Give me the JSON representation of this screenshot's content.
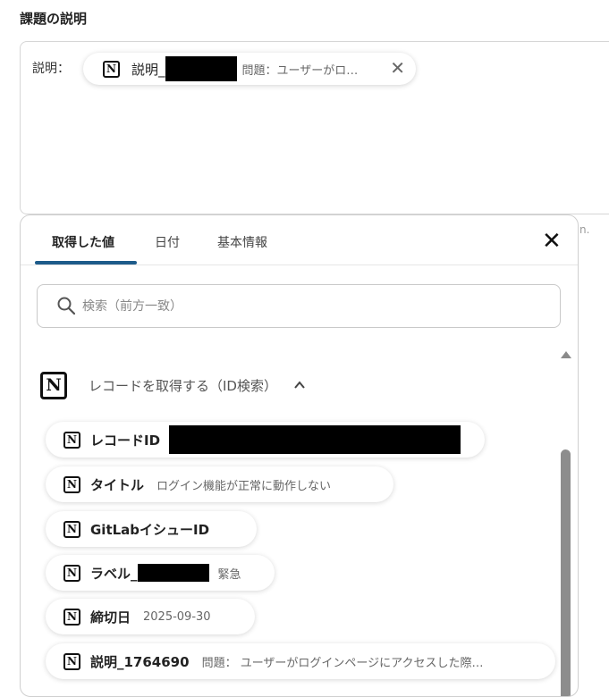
{
  "section_title": "課題の説明",
  "description": {
    "prefix": "説明：",
    "token": {
      "name": "説明_",
      "preview": "問題：ユーザーがロ…"
    }
  },
  "behind_hint": "n.",
  "panel": {
    "tabs": [
      "取得した値",
      "日付",
      "基本情報"
    ],
    "active_tab": 0,
    "search": {
      "placeholder": "検索（前方一致）"
    },
    "group": {
      "title": "レコードを取得する（ID検索）"
    },
    "items": [
      {
        "label": "レコードID",
        "value": ""
      },
      {
        "label": "タイトル",
        "value": "ログイン機能が正常に動作しない"
      },
      {
        "label": "GitLabイシューID",
        "value": ""
      },
      {
        "label": "ラベル_",
        "value": "緊急"
      },
      {
        "label": "締切日",
        "value": "2025-09-30"
      },
      {
        "label": "説明_1764690",
        "value": "問題： ユーザーがログインページにアクセスした際…"
      }
    ]
  },
  "icons": {
    "notion": "notion-icon",
    "close": "close-icon",
    "search": "search-icon",
    "chevron": "chevron-up-icon"
  },
  "colors": {
    "accent": "#1d5b8a",
    "scrollbar": "#8d8d8d"
  }
}
